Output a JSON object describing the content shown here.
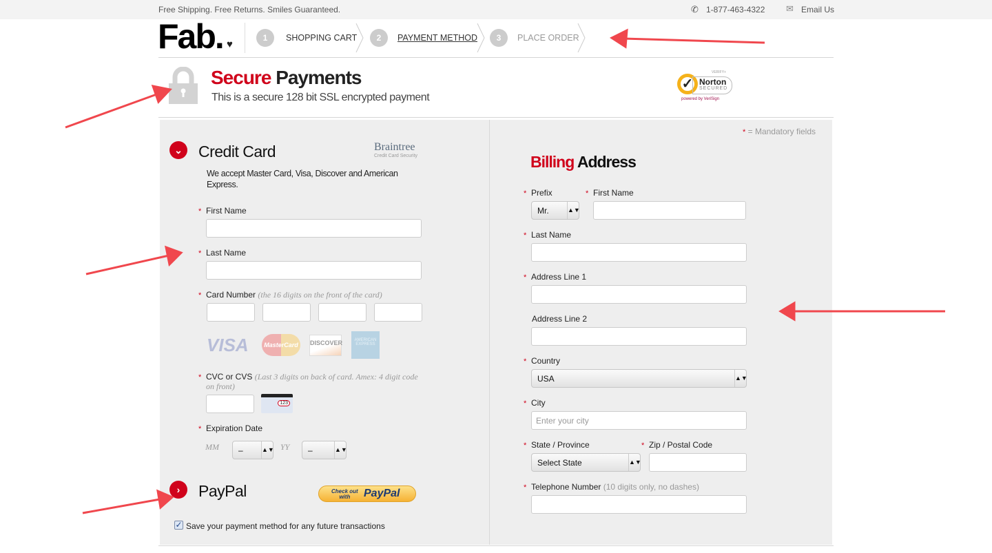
{
  "topbar": {
    "tagline": "Free Shipping. Free Returns. Smiles Guaranteed.",
    "phone": "1-877-463-4322",
    "email": "Email Us"
  },
  "logo": "Fab.",
  "steps": [
    {
      "num": "1",
      "label": "SHOPPING CART"
    },
    {
      "num": "2",
      "label": "PAYMENT METHOD",
      "active": true
    },
    {
      "num": "3",
      "label": "PLACE ORDER"
    }
  ],
  "secure": {
    "title_red": "Secure",
    "title_black": "Payments",
    "subtitle": "This is a secure 128 bit SSL encrypted payment",
    "norton_top": "VERIFY+",
    "norton_name": "Norton",
    "norton_secured": "SECURED",
    "norton_powered": "powered by VeriSign"
  },
  "mandatory": "= Mandatory fields",
  "credit_card": {
    "title": "Credit Card",
    "braintree": "Braintree",
    "braintree_sub": "Credit Card Security",
    "accept": "We accept Master Card, Visa, Discover and American Express.",
    "first_name": "First Name",
    "last_name": "Last Name",
    "card_number": "Card Number",
    "card_number_hint": "(the 16 digits on the front of the card)",
    "cards": [
      "VISA",
      "MasterCard",
      "DISCOVER",
      "AMERICAN EXPRESS"
    ],
    "cvc": "CVC or CVS",
    "cvc_hint": "(Last 3 digits on back of card. Amex: 4 digit code on front)",
    "cvc_img": "123",
    "expiration": "Expiration Date",
    "mm": "MM",
    "yy": "YY",
    "mm_value": "–",
    "yy_value": "–"
  },
  "paypal": {
    "title": "PayPal",
    "button_top": "Check out",
    "button_bottom": "with",
    "button_brand": "PayPal"
  },
  "save": {
    "label": "Save your payment method for any future transactions",
    "checked": true
  },
  "billing": {
    "title_red": "Billing",
    "title_black": "Address",
    "prefix": "Prefix",
    "prefix_value": "Mr.",
    "first_name": "First Name",
    "last_name": "Last Name",
    "address1": "Address Line 1",
    "address2": "Address Line 2",
    "country": "Country",
    "country_value": "USA",
    "city": "City",
    "city_placeholder": "Enter your city",
    "state": "State / Province",
    "state_value": "Select State",
    "zip": "Zip / Postal Code",
    "phone": "Telephone Number",
    "phone_hint": "(10 digits only, no dashes)"
  },
  "colors": {
    "accent": "#d0021b",
    "panel": "#eeeeee",
    "arrow": "#f0474d"
  }
}
